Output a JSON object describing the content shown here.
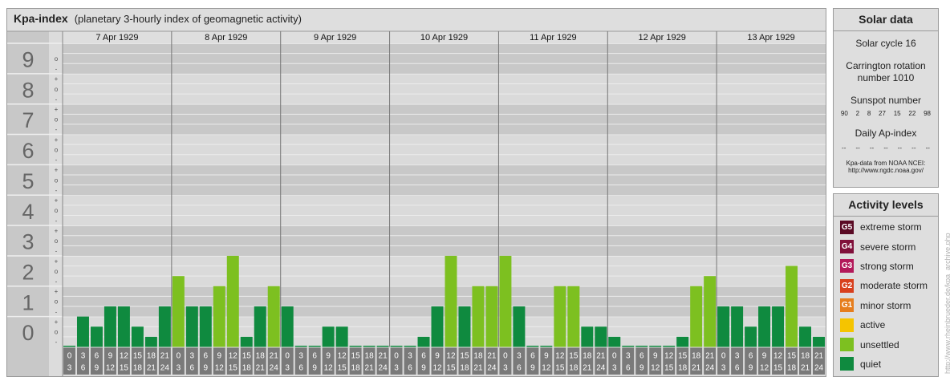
{
  "title": {
    "main": "Kpa-index",
    "sub": "(planetary 3-hourly index of geomagnetic activity)"
  },
  "chart_data": {
    "type": "bar",
    "y_levels": [
      "0",
      "1",
      "2",
      "3",
      "4",
      "5",
      "6",
      "7",
      "8",
      "9"
    ],
    "minor_labels": [
      "-",
      "o",
      "+"
    ],
    "ylim": [
      0,
      9
    ],
    "days": [
      "7 Apr 1929",
      "8 Apr 1929",
      "9 Apr 1929",
      "10 Apr 1929",
      "11 Apr 1929",
      "12 Apr 1929",
      "13 Apr 1929"
    ],
    "interval_labels": [
      [
        "0",
        "3"
      ],
      [
        "3",
        "6"
      ],
      [
        "6",
        "9"
      ],
      [
        "9",
        "12"
      ],
      [
        "12",
        "15"
      ],
      [
        "15",
        "18"
      ],
      [
        "18",
        "21"
      ],
      [
        "21",
        "24"
      ]
    ],
    "values": [
      [
        0,
        1,
        0.667,
        1.333,
        1.333,
        0.667,
        0.333,
        1.333
      ],
      [
        2.333,
        1.333,
        1.333,
        2,
        3,
        0.333,
        1.333,
        2
      ],
      [
        1.333,
        0,
        0,
        0.667,
        0.667,
        0,
        0,
        0
      ],
      [
        0,
        0,
        0.333,
        1.333,
        3,
        1.333,
        2,
        2
      ],
      [
        3,
        1.333,
        0,
        0,
        2,
        2,
        0.667,
        0.667
      ],
      [
        0.333,
        0,
        0,
        0,
        0,
        0.333,
        2,
        2.333
      ],
      [
        1.333,
        1.333,
        0.667,
        1.333,
        1.333,
        2.667,
        0.667,
        0.333
      ]
    ],
    "level_colors": {
      "quiet": "#0f8a3f",
      "unsettled": "#7dc020"
    },
    "unsettled_threshold": 2
  },
  "solar": {
    "title": "Solar data",
    "cycle": "Solar cycle 16",
    "carrington_line1": "Carrington rotation",
    "carrington_line2": "number 1010",
    "sunspot_title": "Sunspot number",
    "sunspot_values": [
      "90",
      "2",
      "8",
      "27",
      "15",
      "22",
      "98"
    ],
    "ap_title": "Daily Ap-index",
    "ap_values": [
      "--",
      "--",
      "--",
      "--",
      "--",
      "--",
      "--"
    ],
    "source_line1": "Kpa-data from NOAA NCEI:",
    "source_line2": "http://www.ngdc.noaa.gov/"
  },
  "activity": {
    "title": "Activity levels",
    "levels": [
      {
        "code": "G5",
        "label": "extreme storm",
        "color": "#5a0a24"
      },
      {
        "code": "G4",
        "label": "severe storm",
        "color": "#80103a"
      },
      {
        "code": "G3",
        "label": "strong storm",
        "color": "#b3195a"
      },
      {
        "code": "G2",
        "label": "moderate storm",
        "color": "#d8401e"
      },
      {
        "code": "G1",
        "label": "minor storm",
        "color": "#e67e1e"
      },
      {
        "code": "",
        "label": "active",
        "color": "#f5c400"
      },
      {
        "code": "",
        "label": "unsettled",
        "color": "#7dc020"
      },
      {
        "code": "",
        "label": "quiet",
        "color": "#0f8a3f"
      }
    ]
  },
  "watermark": "http://www.rheinbrueder.de/kpa_archive.php"
}
